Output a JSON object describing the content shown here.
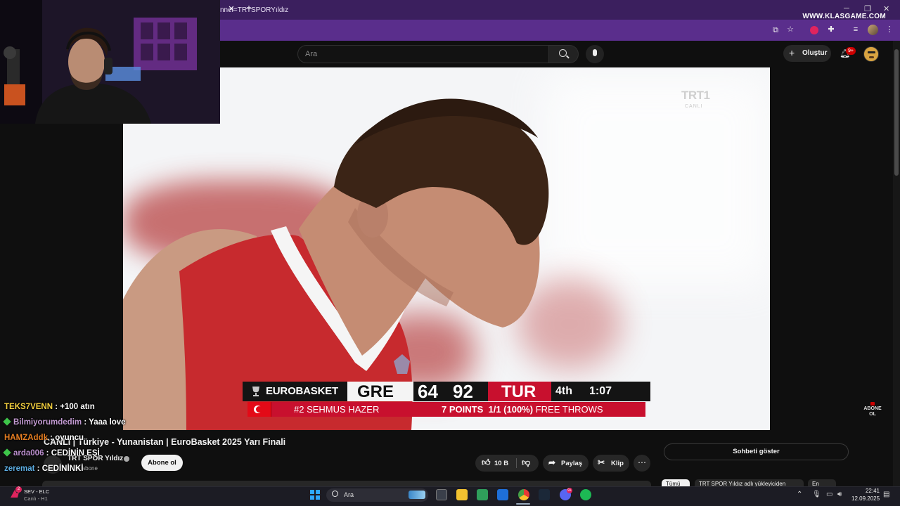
{
  "browser": {
    "url_fragment": "nnel=TRTSPORYıldız",
    "watermark": "WWW.KLASGAME.COM"
  },
  "youtube": {
    "search_placeholder": "Ara",
    "create_label": "Oluştur",
    "notification_count": "9+",
    "video": {
      "broadcaster_logo": "TRT1",
      "broadcaster_live": "CANLI",
      "scoreboard": {
        "competition": "EUROBASKET",
        "home_team": "GRE",
        "home_score": "64",
        "away_score": "92",
        "away_team": "TUR",
        "period": "4th",
        "clock": "1:07",
        "player": "#2 SEHMUS HAZER",
        "stat_points": "7 POINTS",
        "stat_throws": "1/1 (100%)",
        "stat_label": "FREE THROWS"
      },
      "subscribe_watermark": "ABONE OL"
    },
    "title": "CANLI | Türkiye - Yunanistan | EuroBasket 2025 Yarı Finali",
    "channel_name": "TRT SPOR Yıldız",
    "channel_subs": "n abone",
    "subscribe_label": "Abone ol",
    "like_count": "10 B",
    "share_label": "Paylaş",
    "clip_label": "Klip",
    "more_label": "⋯",
    "show_chat_label": "Sohbeti göster",
    "chips": [
      "Tümü",
      "TRT SPOR Yıldız adlı yükleyiciden",
      "En"
    ]
  },
  "stream_chat": [
    {
      "user": "TEKS7VENN",
      "message": " : +100 atın",
      "color": "#f4d03f",
      "gem": false
    },
    {
      "user": "Bilmiyorumdedim",
      "message": " : Yaaa love",
      "color": "#c39bd3",
      "gem": true
    },
    {
      "user": "HAMZAddk",
      "message": " : oyuncu",
      "color": "#e67e22",
      "gem": false
    },
    {
      "user": "arda006",
      "message": " : CEDİNİN EŞİ",
      "color": "#bb8fce",
      "gem": true
    },
    {
      "user": "zeremat",
      "message": " : CEDİNİNKİ",
      "color": "#5dade2",
      "gem": false
    }
  ],
  "taskbar": {
    "weather_line1": "SEV - ELC",
    "weather_line2": "Canlı - H1",
    "weather_badge": "2",
    "search_placeholder": "Ara",
    "discord_badge": "9+",
    "time": "22:41",
    "date": "12.09.2025"
  }
}
